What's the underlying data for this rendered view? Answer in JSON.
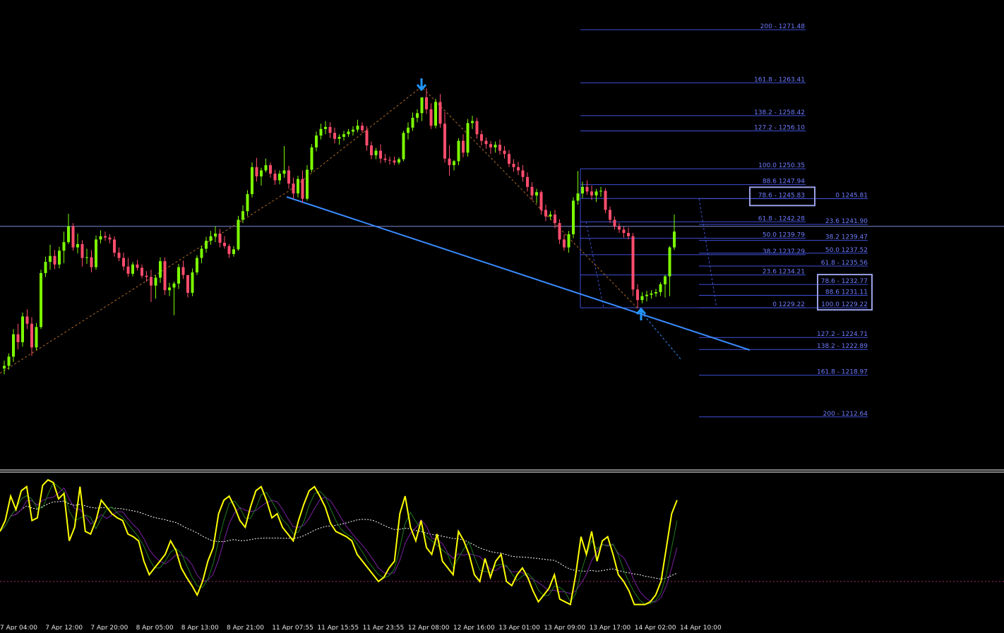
{
  "chart_data": {
    "type": "candlestick",
    "timeframe_note": "",
    "price_axis": {
      "min": 1205,
      "max": 1276
    },
    "colors": {
      "background": "#000000",
      "bull": "#7cfc00",
      "bear": "#ff4d6d",
      "fib": "#3f51d8",
      "fib_text": "#6f7cff",
      "trend_blue": "#3a8bff",
      "zigzag": "#b06a2a",
      "box": "#9aa0e6",
      "osc_main": "#ffff00",
      "osc_signal_green": "#1f7a1f",
      "osc_signal_purple": "#7a1fa2",
      "osc_ma": "#ffffff",
      "osc_level": "#a0306e",
      "separator": "#ffffff"
    },
    "candles": [
      {
        "o": 1220.0,
        "h": 1221.2,
        "l": 1219.1,
        "c": 1220.4
      },
      {
        "o": 1220.4,
        "h": 1222.3,
        "l": 1219.8,
        "c": 1221.8
      },
      {
        "o": 1221.8,
        "h": 1226.0,
        "l": 1221.0,
        "c": 1225.2
      },
      {
        "o": 1225.2,
        "h": 1226.8,
        "l": 1222.9,
        "c": 1224.0
      },
      {
        "o": 1224.0,
        "h": 1228.5,
        "l": 1223.3,
        "c": 1227.9
      },
      {
        "o": 1227.9,
        "h": 1229.0,
        "l": 1226.0,
        "c": 1226.8
      },
      {
        "o": 1226.8,
        "h": 1227.8,
        "l": 1221.9,
        "c": 1223.2
      },
      {
        "o": 1223.2,
        "h": 1226.9,
        "l": 1222.8,
        "c": 1226.3
      },
      {
        "o": 1226.3,
        "h": 1235.0,
        "l": 1226.0,
        "c": 1234.5
      },
      {
        "o": 1234.5,
        "h": 1237.0,
        "l": 1233.9,
        "c": 1236.2
      },
      {
        "o": 1236.2,
        "h": 1238.8,
        "l": 1235.0,
        "c": 1237.1
      },
      {
        "o": 1237.1,
        "h": 1238.0,
        "l": 1235.1,
        "c": 1235.8
      },
      {
        "o": 1235.8,
        "h": 1238.5,
        "l": 1235.2,
        "c": 1237.9
      },
      {
        "o": 1237.9,
        "h": 1240.8,
        "l": 1236.0,
        "c": 1239.2
      },
      {
        "o": 1239.2,
        "h": 1243.5,
        "l": 1238.9,
        "c": 1241.6
      },
      {
        "o": 1241.6,
        "h": 1242.1,
        "l": 1237.9,
        "c": 1238.4
      },
      {
        "o": 1238.4,
        "h": 1240.5,
        "l": 1237.5,
        "c": 1238.9
      },
      {
        "o": 1238.9,
        "h": 1239.5,
        "l": 1235.5,
        "c": 1236.8
      },
      {
        "o": 1236.8,
        "h": 1238.2,
        "l": 1235.9,
        "c": 1236.9
      },
      {
        "o": 1236.9,
        "h": 1238.0,
        "l": 1234.6,
        "c": 1235.4
      },
      {
        "o": 1235.4,
        "h": 1240.2,
        "l": 1235.0,
        "c": 1239.6
      },
      {
        "o": 1239.6,
        "h": 1241.0,
        "l": 1239.0,
        "c": 1240.1
      },
      {
        "o": 1240.1,
        "h": 1240.8,
        "l": 1239.4,
        "c": 1239.9
      },
      {
        "o": 1239.9,
        "h": 1240.4,
        "l": 1239.0,
        "c": 1239.6
      },
      {
        "o": 1239.6,
        "h": 1240.1,
        "l": 1237.0,
        "c": 1237.6
      },
      {
        "o": 1237.6,
        "h": 1238.4,
        "l": 1236.3,
        "c": 1236.8
      },
      {
        "o": 1236.8,
        "h": 1237.6,
        "l": 1234.9,
        "c": 1235.5
      },
      {
        "o": 1235.5,
        "h": 1236.8,
        "l": 1233.9,
        "c": 1234.4
      },
      {
        "o": 1234.4,
        "h": 1236.2,
        "l": 1234.0,
        "c": 1235.8
      },
      {
        "o": 1235.8,
        "h": 1236.5,
        "l": 1234.9,
        "c": 1235.3
      },
      {
        "o": 1235.3,
        "h": 1235.8,
        "l": 1233.7,
        "c": 1234.1
      },
      {
        "o": 1234.1,
        "h": 1234.8,
        "l": 1233.2,
        "c": 1233.9
      },
      {
        "o": 1233.9,
        "h": 1235.0,
        "l": 1230.1,
        "c": 1232.6
      },
      {
        "o": 1232.6,
        "h": 1234.2,
        "l": 1230.6,
        "c": 1233.8
      },
      {
        "o": 1233.8,
        "h": 1236.9,
        "l": 1233.0,
        "c": 1236.3
      },
      {
        "o": 1236.3,
        "h": 1236.9,
        "l": 1231.2,
        "c": 1231.9
      },
      {
        "o": 1231.9,
        "h": 1233.0,
        "l": 1231.0,
        "c": 1232.3
      },
      {
        "o": 1232.3,
        "h": 1233.2,
        "l": 1228.1,
        "c": 1232.9
      },
      {
        "o": 1232.9,
        "h": 1235.9,
        "l": 1232.1,
        "c": 1235.4
      },
      {
        "o": 1235.4,
        "h": 1236.4,
        "l": 1233.6,
        "c": 1234.2
      },
      {
        "o": 1234.2,
        "h": 1233.9,
        "l": 1230.8,
        "c": 1231.5
      },
      {
        "o": 1231.5,
        "h": 1235.2,
        "l": 1231.0,
        "c": 1234.6
      },
      {
        "o": 1234.6,
        "h": 1237.2,
        "l": 1234.2,
        "c": 1236.8
      },
      {
        "o": 1236.8,
        "h": 1238.6,
        "l": 1236.0,
        "c": 1238.2
      },
      {
        "o": 1238.2,
        "h": 1240.0,
        "l": 1237.6,
        "c": 1239.4
      },
      {
        "o": 1239.4,
        "h": 1240.9,
        "l": 1238.8,
        "c": 1240.1
      },
      {
        "o": 1240.1,
        "h": 1241.6,
        "l": 1239.2,
        "c": 1240.5
      },
      {
        "o": 1240.5,
        "h": 1241.2,
        "l": 1238.4,
        "c": 1239.1
      },
      {
        "o": 1239.1,
        "h": 1240.1,
        "l": 1238.2,
        "c": 1238.6
      },
      {
        "o": 1238.6,
        "h": 1238.9,
        "l": 1236.8,
        "c": 1237.4
      },
      {
        "o": 1237.4,
        "h": 1238.6,
        "l": 1237.0,
        "c": 1238.1
      },
      {
        "o": 1238.1,
        "h": 1243.2,
        "l": 1237.9,
        "c": 1242.6
      },
      {
        "o": 1242.6,
        "h": 1244.8,
        "l": 1242.1,
        "c": 1243.9
      },
      {
        "o": 1243.9,
        "h": 1247.1,
        "l": 1243.2,
        "c": 1246.5
      },
      {
        "o": 1246.5,
        "h": 1251.3,
        "l": 1246.0,
        "c": 1250.6
      },
      {
        "o": 1250.6,
        "h": 1252.0,
        "l": 1248.4,
        "c": 1249.2
      },
      {
        "o": 1249.2,
        "h": 1250.5,
        "l": 1247.8,
        "c": 1250.1
      },
      {
        "o": 1250.1,
        "h": 1251.9,
        "l": 1249.8,
        "c": 1250.9
      },
      {
        "o": 1250.9,
        "h": 1251.3,
        "l": 1249.0,
        "c": 1249.6
      },
      {
        "o": 1249.6,
        "h": 1250.2,
        "l": 1247.9,
        "c": 1248.6
      },
      {
        "o": 1248.6,
        "h": 1250.1,
        "l": 1248.0,
        "c": 1249.6
      },
      {
        "o": 1249.6,
        "h": 1253.8,
        "l": 1249.0,
        "c": 1250.1
      },
      {
        "o": 1250.1,
        "h": 1250.8,
        "l": 1247.3,
        "c": 1248.1
      },
      {
        "o": 1248.1,
        "h": 1249.0,
        "l": 1245.8,
        "c": 1246.6
      },
      {
        "o": 1246.6,
        "h": 1249.3,
        "l": 1246.0,
        "c": 1248.8
      },
      {
        "o": 1248.8,
        "h": 1250.1,
        "l": 1245.2,
        "c": 1245.8
      },
      {
        "o": 1245.8,
        "h": 1250.9,
        "l": 1245.5,
        "c": 1250.2
      },
      {
        "o": 1250.2,
        "h": 1254.1,
        "l": 1249.8,
        "c": 1253.6
      },
      {
        "o": 1253.6,
        "h": 1256.0,
        "l": 1253.0,
        "c": 1255.4
      },
      {
        "o": 1255.4,
        "h": 1257.2,
        "l": 1254.8,
        "c": 1256.4
      },
      {
        "o": 1256.4,
        "h": 1257.6,
        "l": 1255.6,
        "c": 1256.7
      },
      {
        "o": 1256.7,
        "h": 1257.4,
        "l": 1255.0,
        "c": 1255.8
      },
      {
        "o": 1255.8,
        "h": 1256.6,
        "l": 1254.2,
        "c": 1254.9
      },
      {
        "o": 1254.9,
        "h": 1255.6,
        "l": 1254.0,
        "c": 1255.2
      },
      {
        "o": 1255.2,
        "h": 1256.1,
        "l": 1254.6,
        "c": 1255.6
      },
      {
        "o": 1255.6,
        "h": 1256.4,
        "l": 1255.2,
        "c": 1256.0
      },
      {
        "o": 1256.0,
        "h": 1256.8,
        "l": 1255.4,
        "c": 1256.3
      },
      {
        "o": 1256.3,
        "h": 1257.8,
        "l": 1255.9,
        "c": 1256.9
      },
      {
        "o": 1256.9,
        "h": 1257.4,
        "l": 1255.8,
        "c": 1256.2
      },
      {
        "o": 1256.2,
        "h": 1256.8,
        "l": 1253.1,
        "c": 1253.9
      },
      {
        "o": 1253.9,
        "h": 1254.5,
        "l": 1251.8,
        "c": 1252.4
      },
      {
        "o": 1252.4,
        "h": 1253.5,
        "l": 1251.8,
        "c": 1253.1
      },
      {
        "o": 1253.1,
        "h": 1254.1,
        "l": 1251.2,
        "c": 1251.9
      },
      {
        "o": 1251.9,
        "h": 1252.6,
        "l": 1251.3,
        "c": 1251.7
      },
      {
        "o": 1251.7,
        "h": 1252.2,
        "l": 1251.0,
        "c": 1251.6
      },
      {
        "o": 1251.6,
        "h": 1252.2,
        "l": 1250.9,
        "c": 1251.3
      },
      {
        "o": 1251.3,
        "h": 1252.1,
        "l": 1251.0,
        "c": 1251.8
      },
      {
        "o": 1251.8,
        "h": 1256.1,
        "l": 1251.5,
        "c": 1255.8
      },
      {
        "o": 1255.8,
        "h": 1257.4,
        "l": 1254.8,
        "c": 1256.6
      },
      {
        "o": 1256.6,
        "h": 1258.9,
        "l": 1256.1,
        "c": 1258.1
      },
      {
        "o": 1258.1,
        "h": 1259.4,
        "l": 1257.4,
        "c": 1258.8
      },
      {
        "o": 1258.8,
        "h": 1260.1,
        "l": 1257.6,
        "c": 1261.2
      },
      {
        "o": 1261.2,
        "h": 1262.6,
        "l": 1258.7,
        "c": 1259.4
      },
      {
        "o": 1259.4,
        "h": 1260.3,
        "l": 1256.4,
        "c": 1256.9
      },
      {
        "o": 1256.9,
        "h": 1261.0,
        "l": 1256.5,
        "c": 1260.5
      },
      {
        "o": 1260.5,
        "h": 1261.7,
        "l": 1256.6,
        "c": 1257.2
      },
      {
        "o": 1257.2,
        "h": 1259.0,
        "l": 1251.3,
        "c": 1251.9
      },
      {
        "o": 1251.9,
        "h": 1253.9,
        "l": 1249.3,
        "c": 1250.9
      },
      {
        "o": 1250.9,
        "h": 1251.7,
        "l": 1250.1,
        "c": 1251.5
      },
      {
        "o": 1251.5,
        "h": 1255.0,
        "l": 1250.9,
        "c": 1254.6
      },
      {
        "o": 1254.6,
        "h": 1255.6,
        "l": 1252.1,
        "c": 1252.8
      },
      {
        "o": 1252.8,
        "h": 1257.9,
        "l": 1252.2,
        "c": 1257.3
      },
      {
        "o": 1257.3,
        "h": 1258.4,
        "l": 1256.4,
        "c": 1257.6
      },
      {
        "o": 1257.6,
        "h": 1258.1,
        "l": 1254.9,
        "c": 1255.6
      },
      {
        "o": 1255.6,
        "h": 1256.2,
        "l": 1253.9,
        "c": 1254.6
      },
      {
        "o": 1254.6,
        "h": 1255.1,
        "l": 1253.4,
        "c": 1254.1
      },
      {
        "o": 1254.1,
        "h": 1254.6,
        "l": 1252.6,
        "c": 1253.6
      },
      {
        "o": 1253.6,
        "h": 1254.5,
        "l": 1252.8,
        "c": 1254.0
      },
      {
        "o": 1254.0,
        "h": 1254.8,
        "l": 1252.5,
        "c": 1253.1
      },
      {
        "o": 1253.1,
        "h": 1253.8,
        "l": 1251.9,
        "c": 1252.6
      },
      {
        "o": 1252.6,
        "h": 1253.2,
        "l": 1250.6,
        "c": 1251.1
      },
      {
        "o": 1251.1,
        "h": 1251.8,
        "l": 1249.9,
        "c": 1250.6
      },
      {
        "o": 1250.6,
        "h": 1251.4,
        "l": 1249.4,
        "c": 1250.1
      },
      {
        "o": 1250.1,
        "h": 1250.9,
        "l": 1248.4,
        "c": 1249.1
      },
      {
        "o": 1249.1,
        "h": 1249.8,
        "l": 1246.9,
        "c": 1247.6
      },
      {
        "o": 1247.6,
        "h": 1248.3,
        "l": 1245.6,
        "c": 1246.3
      },
      {
        "o": 1246.3,
        "h": 1247.3,
        "l": 1245.1,
        "c": 1246.8
      },
      {
        "o": 1246.8,
        "h": 1247.1,
        "l": 1243.4,
        "c": 1244.1
      },
      {
        "o": 1244.1,
        "h": 1244.9,
        "l": 1242.4,
        "c": 1243.1
      },
      {
        "o": 1243.1,
        "h": 1243.9,
        "l": 1242.6,
        "c": 1243.4
      },
      {
        "o": 1243.4,
        "h": 1244.1,
        "l": 1241.3,
        "c": 1242.1
      },
      {
        "o": 1242.1,
        "h": 1242.7,
        "l": 1238.9,
        "c": 1239.6
      },
      {
        "o": 1239.6,
        "h": 1240.4,
        "l": 1237.9,
        "c": 1238.4
      },
      {
        "o": 1238.4,
        "h": 1240.9,
        "l": 1237.6,
        "c": 1240.4
      },
      {
        "o": 1240.4,
        "h": 1246.0,
        "l": 1239.8,
        "c": 1245.5
      },
      {
        "o": 1245.5,
        "h": 1250.0,
        "l": 1244.9,
        "c": 1246.6
      },
      {
        "o": 1246.6,
        "h": 1248.4,
        "l": 1245.9,
        "c": 1247.6
      },
      {
        "o": 1247.6,
        "h": 1248.6,
        "l": 1246.4,
        "c": 1246.9
      },
      {
        "o": 1246.9,
        "h": 1247.8,
        "l": 1245.6,
        "c": 1246.3
      },
      {
        "o": 1246.3,
        "h": 1247.3,
        "l": 1245.3,
        "c": 1246.9
      },
      {
        "o": 1246.9,
        "h": 1247.6,
        "l": 1246.1,
        "c": 1247.0
      },
      {
        "o": 1247.0,
        "h": 1247.4,
        "l": 1243.6,
        "c": 1244.1
      },
      {
        "o": 1244.1,
        "h": 1244.6,
        "l": 1242.1,
        "c": 1242.6
      },
      {
        "o": 1242.6,
        "h": 1243.1,
        "l": 1241.1,
        "c": 1241.6
      },
      {
        "o": 1241.6,
        "h": 1242.1,
        "l": 1240.6,
        "c": 1241.1
      },
      {
        "o": 1241.1,
        "h": 1241.6,
        "l": 1239.9,
        "c": 1240.6
      },
      {
        "o": 1240.6,
        "h": 1241.4,
        "l": 1239.6,
        "c": 1240.1
      },
      {
        "o": 1240.1,
        "h": 1240.6,
        "l": 1231.0,
        "c": 1232.0
      },
      {
        "o": 1232.0,
        "h": 1232.8,
        "l": 1229.2,
        "c": 1230.4
      },
      {
        "o": 1230.4,
        "h": 1231.6,
        "l": 1229.9,
        "c": 1231.0
      },
      {
        "o": 1231.0,
        "h": 1231.8,
        "l": 1230.2,
        "c": 1231.2
      },
      {
        "o": 1231.2,
        "h": 1231.9,
        "l": 1230.6,
        "c": 1231.4
      },
      {
        "o": 1231.4,
        "h": 1232.1,
        "l": 1230.9,
        "c": 1231.6
      },
      {
        "o": 1231.6,
        "h": 1233.1,
        "l": 1231.0,
        "c": 1232.8
      },
      {
        "o": 1232.8,
        "h": 1234.2,
        "l": 1230.8,
        "c": 1234.0
      },
      {
        "o": 1234.0,
        "h": 1238.6,
        "l": 1231.0,
        "c": 1238.4
      },
      {
        "o": 1238.4,
        "h": 1243.4,
        "l": 1238.0,
        "c": 1240.8
      }
    ],
    "price_line": 1241.6,
    "time_labels": [
      "7 Apr 04:00",
      "7 Apr 12:00",
      "7 Apr 20:00",
      "8 Apr 05:00",
      "8 Apr 13:00",
      "8 Apr 21:00",
      "11 Apr 07:55",
      "11 Apr 15:55",
      "11 Apr 23:55",
      "12 Apr 08:00",
      "12 Apr 16:00",
      "13 Apr 01:00",
      "13 Apr 09:00",
      "13 Apr 17:00",
      "14 Apr 02:00",
      "14 Apr 10:00"
    ],
    "fib_set_1": [
      {
        "label": "200 - 1271.48",
        "price": 1271.48
      },
      {
        "label": "161.8 - 1263.41",
        "price": 1263.41
      },
      {
        "label": "138.2 - 1258.42",
        "price": 1258.42
      },
      {
        "label": "127.2 - 1256.10",
        "price": 1256.1
      },
      {
        "label": "100.0 1250.35",
        "price": 1250.35
      },
      {
        "label": "88.6 1247.94",
        "price": 1247.94
      },
      {
        "label": "78.6 - 1245.83",
        "price": 1245.83
      },
      {
        "label": "61.8 - 1242.28",
        "price": 1242.28
      },
      {
        "label": "50.0 1239.79",
        "price": 1239.79
      },
      {
        "label": "38.2 1237.29",
        "price": 1237.29
      },
      {
        "label": "23.6 1234.21",
        "price": 1234.21
      },
      {
        "label": "0 1229.22",
        "price": 1229.22
      }
    ],
    "fib_set_2": [
      {
        "label": "0 1245.81",
        "price": 1245.81
      },
      {
        "label": "23.6 1241.90",
        "price": 1241.9
      },
      {
        "label": "38.2 1239.47",
        "price": 1239.47
      },
      {
        "label": "50.0 1237.52",
        "price": 1237.52
      },
      {
        "label": "61.8 - 1235.56",
        "price": 1235.56
      },
      {
        "label": "78.6 - 1232.77",
        "price": 1232.77
      },
      {
        "label": "88.6 1231.11",
        "price": 1231.11
      },
      {
        "label": "100.0 1229.22",
        "price": 1229.22
      },
      {
        "label": "127.2 - 1224.71",
        "price": 1224.71
      },
      {
        "label": "138.2 - 1222.89",
        "price": 1222.89
      },
      {
        "label": "161.8 - 1218.97",
        "price": 1218.97
      },
      {
        "label": "200 - 1212.64",
        "price": 1212.64
      }
    ],
    "oscillator": {
      "range": [
        0,
        100
      ],
      "level": 25,
      "main": [
        62,
        70,
        88,
        78,
        92,
        95,
        70,
        72,
        96,
        100,
        98,
        86,
        90,
        55,
        65,
        95,
        62,
        60,
        70,
        85,
        80,
        75,
        72,
        70,
        60,
        58,
        55,
        40,
        30,
        35,
        40,
        45,
        55,
        48,
        35,
        28,
        22,
        15,
        25,
        40,
        50,
        75,
        85,
        88,
        80,
        70,
        65,
        80,
        92,
        95,
        85,
        72,
        75,
        65,
        60,
        55,
        70,
        82,
        92,
        95,
        88,
        80,
        68,
        62,
        60,
        58,
        55,
        45,
        40,
        35,
        30,
        25,
        28,
        35,
        40,
        75,
        88,
        65,
        55,
        70,
        50,
        45,
        60,
        40,
        35,
        30,
        62,
        55,
        45,
        30,
        25,
        42,
        28,
        40,
        45,
        25,
        22,
        30,
        35,
        28,
        18,
        10,
        15,
        20,
        30,
        12,
        10,
        8,
        30,
        58,
        45,
        62,
        40,
        55,
        58,
        45,
        30,
        25,
        18,
        8,
        8,
        8,
        10,
        15,
        25,
        50,
        75,
        85
      ]
    }
  }
}
